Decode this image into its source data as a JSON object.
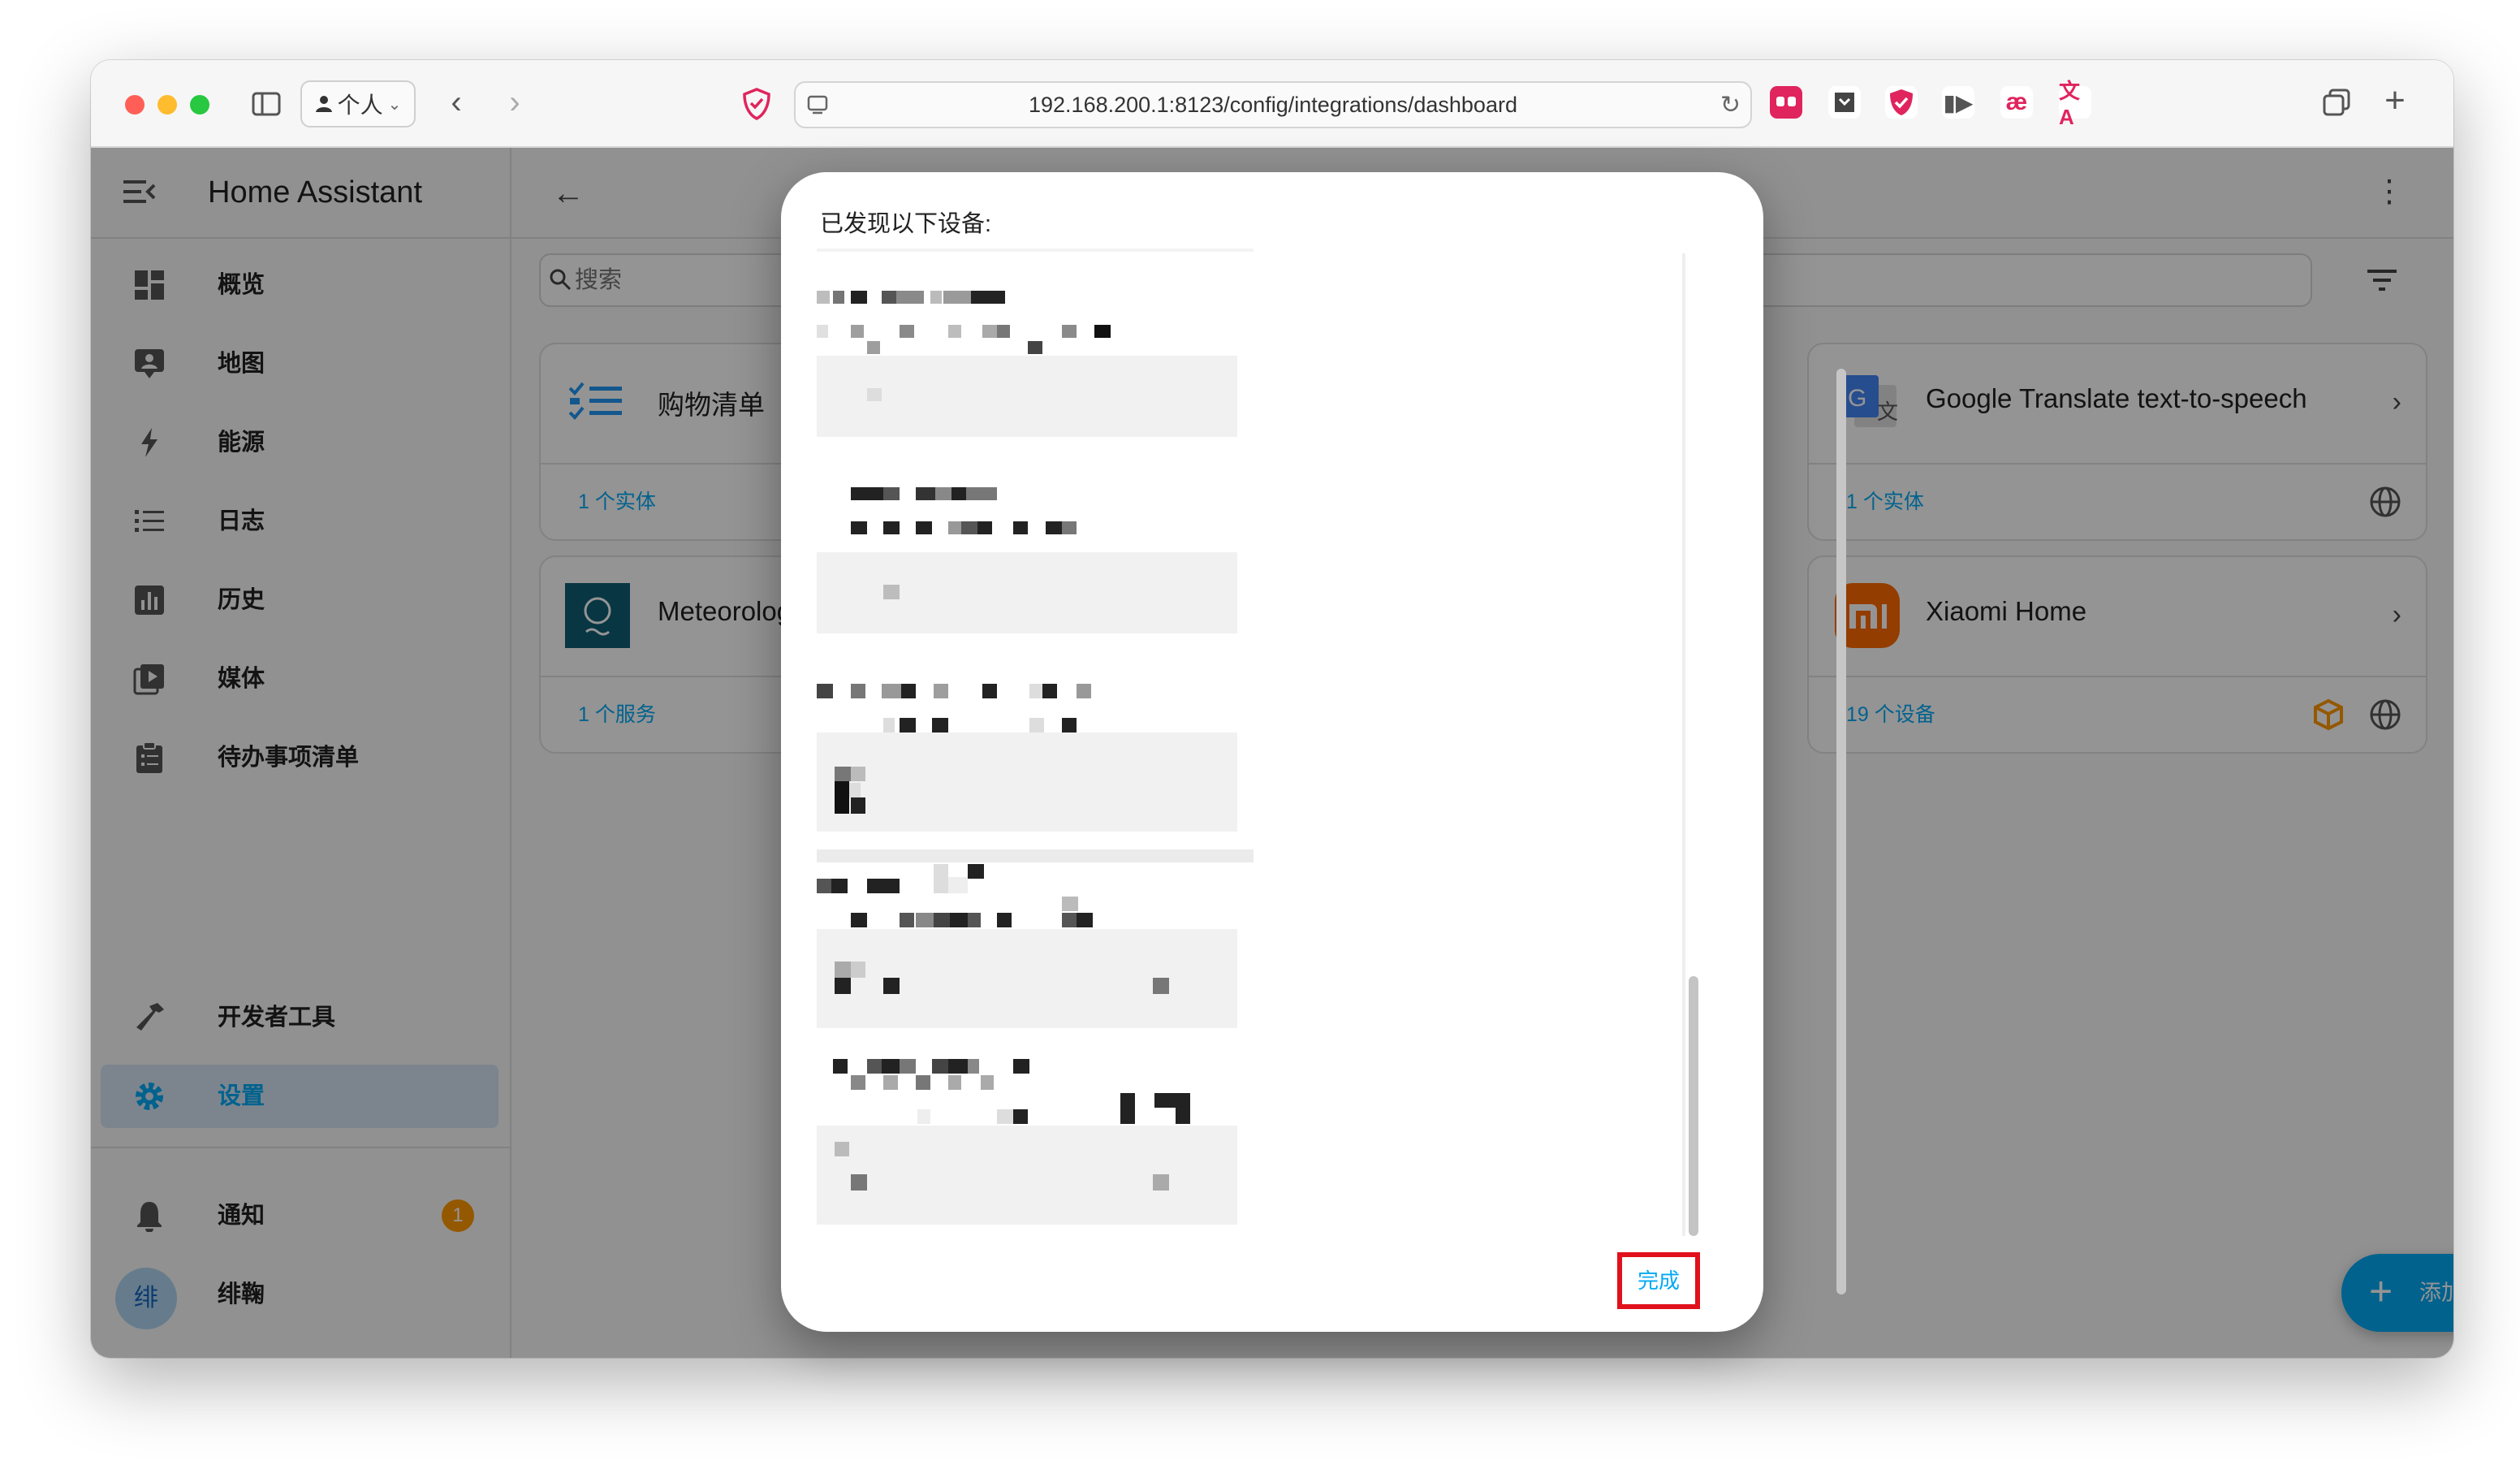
{
  "browser": {
    "profile_label": "个人",
    "url": "192.168.200.1:8123/config/integrations/dashboard"
  },
  "app": {
    "title": "Home Assistant"
  },
  "sidebar": {
    "items": [
      {
        "label": "概览",
        "icon": "dashboard-icon"
      },
      {
        "label": "地图",
        "icon": "map-icon"
      },
      {
        "label": "能源",
        "icon": "lightning-icon"
      },
      {
        "label": "日志",
        "icon": "list-icon"
      },
      {
        "label": "历史",
        "icon": "chart-box-icon"
      },
      {
        "label": "媒体",
        "icon": "media-icon"
      },
      {
        "label": "待办事项清单",
        "icon": "clipboard-list-icon"
      }
    ],
    "developer_tools": "开发者工具",
    "settings": "设置",
    "notifications": "通知",
    "notification_count": "1",
    "user_initial": "绯",
    "user_name": "绯鞠"
  },
  "search": {
    "placeholder": "搜索"
  },
  "cards": [
    {
      "title": "购物清单",
      "link": "1 个实体"
    },
    {
      "title": "Meteorolog",
      "link": "1 个服务"
    },
    {
      "title": "Google Translate text-to-speech",
      "link": "1 个实体"
    },
    {
      "title": "Xiaomi Home",
      "link": "19 个设备"
    }
  ],
  "fab": {
    "label": "添加集成"
  },
  "dialog": {
    "title": "已发现以下设备:",
    "done_label": "完成"
  },
  "colors": {
    "accent": "#03a9f4",
    "highlight_border": "#e0111b",
    "xiaomi_orange": "#ff6900",
    "notification_badge": "#ff9800"
  }
}
